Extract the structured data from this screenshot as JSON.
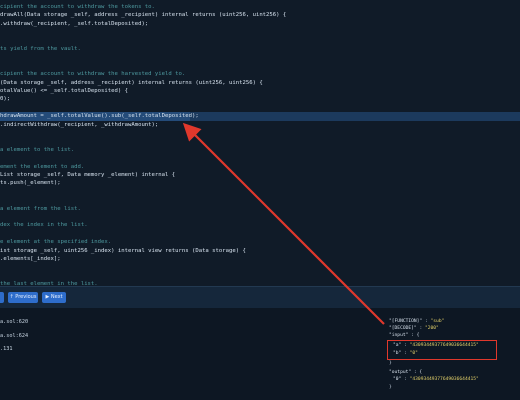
{
  "code_lines": [
    {
      "text": "cipient the account to withdraw the tokens to.",
      "kind": "comment"
    },
    {
      "text": "drawAll(Data storage _self, address _recipient) internal returns (uint256, uint256) {",
      "kind": "code"
    },
    {
      "text": ".withdraw(_recipient, _self.totalDeposited);",
      "kind": "code"
    },
    {
      "text": "",
      "kind": "code"
    },
    {
      "text": "",
      "kind": "code"
    },
    {
      "text": "ts yield from the vault.",
      "kind": "comment"
    },
    {
      "text": "",
      "kind": "code"
    },
    {
      "text": "",
      "kind": "code"
    },
    {
      "text": "cipient the account to withdraw the harvested yield to.",
      "kind": "comment"
    },
    {
      "text": "(Data storage _self, address _recipient) internal returns (uint256, uint256) {",
      "kind": "code"
    },
    {
      "text": "otalValue() <= _self.totalDeposited) {",
      "kind": "code"
    },
    {
      "text": "0);",
      "kind": "code"
    },
    {
      "text": "",
      "kind": "code"
    },
    {
      "text": "hdrawAmount = _self.totalValue().sub(_self.totalDeposited);",
      "kind": "code"
    },
    {
      "text": ".indirectWithdraw(_recipient, _withdrawAmount);",
      "kind": "code"
    },
    {
      "text": "",
      "kind": "code"
    },
    {
      "text": "",
      "kind": "code"
    },
    {
      "text": "a element to the list.",
      "kind": "comment"
    },
    {
      "text": "",
      "kind": "code"
    },
    {
      "text": "ement the element to add.",
      "kind": "comment"
    },
    {
      "text": "List storage _self, Data memory _element) internal {",
      "kind": "code"
    },
    {
      "text": "ts.push(_element);",
      "kind": "code"
    },
    {
      "text": "",
      "kind": "code"
    },
    {
      "text": "",
      "kind": "code"
    },
    {
      "text": "a element from the list.",
      "kind": "comment"
    },
    {
      "text": "",
      "kind": "code"
    },
    {
      "text": "dex the index in the list.",
      "kind": "comment"
    },
    {
      "text": "",
      "kind": "code"
    },
    {
      "text": "e element at the specified index.",
      "kind": "comment"
    },
    {
      "text": "ist storage _self, uint256 _index) internal view returns (Data storage) {",
      "kind": "code"
    },
    {
      "text": ".elements[_index];",
      "kind": "code"
    },
    {
      "text": "",
      "kind": "code"
    },
    {
      "text": "",
      "kind": "code"
    },
    {
      "text": "the last element in the list.",
      "kind": "comment"
    }
  ],
  "toolbar": {
    "btn1_label": "↑ Previous",
    "btn2_label": "▶ Next"
  },
  "bottom_lines": [
    "a.sol:620",
    "a.sol:624",
    ".131"
  ],
  "json_panel": {
    "l1_key": "\"[FUNCTION]\"",
    "l1_val": "\"sub\"",
    "l2_key": "\"[DECODE]\"",
    "l2_val": "\"200\"",
    "l3": "\"input\" : {",
    "l4_key": "\"a\"",
    "l4_val": "\"43093449377649036644415\"",
    "l5_key": "\"b\"",
    "l5_val": "\"0\"",
    "l6": "}",
    "l7": "\"output\" : {",
    "l8_key": "\"0\"",
    "l8_val": "\"43093449377649036644415\"",
    "l9": "}"
  },
  "colors": {
    "background": "#0f1926",
    "highlight": "#1c3a5d",
    "comment": "#4e9aa0",
    "button": "#2e6dcb",
    "annotation": "#e0382c"
  }
}
